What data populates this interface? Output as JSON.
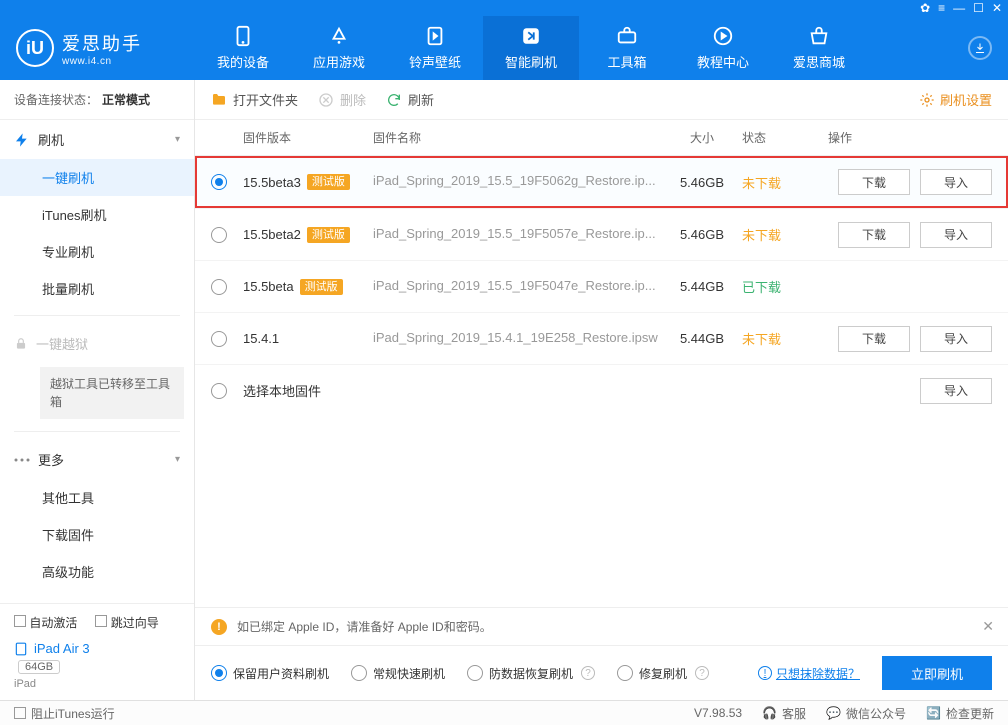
{
  "titlebar": {
    "btns": [
      "✿",
      "≡",
      "—",
      "☐",
      "✕"
    ]
  },
  "brand": {
    "name": "爱思助手",
    "url": "www.i4.cn",
    "initial": "iU"
  },
  "nav": [
    {
      "id": "device",
      "label": "我的设备"
    },
    {
      "id": "apps",
      "label": "应用游戏"
    },
    {
      "id": "ring",
      "label": "铃声壁纸"
    },
    {
      "id": "flash",
      "label": "智能刷机"
    },
    {
      "id": "tools",
      "label": "工具箱"
    },
    {
      "id": "tutorial",
      "label": "教程中心"
    },
    {
      "id": "store",
      "label": "爱思商城"
    }
  ],
  "conn": {
    "prefix": "设备连接状态：",
    "mode": "正常模式"
  },
  "menu": {
    "flash_group": "刷机",
    "flash_items": [
      "一键刷机",
      "iTunes刷机",
      "专业刷机",
      "批量刷机"
    ],
    "jailbreak": "一键越狱",
    "jailbreak_note": "越狱工具已转移至工具箱",
    "more_group": "更多",
    "more_items": [
      "其他工具",
      "下载固件",
      "高级功能"
    ]
  },
  "opts": {
    "auto_activate": "自动激活",
    "skip_guide": "跳过向导"
  },
  "device": {
    "name": "iPad Air 3",
    "capacity": "64GB",
    "type": "iPad"
  },
  "toolbar": {
    "open": "打开文件夹",
    "delete": "删除",
    "refresh": "刷新",
    "settings": "刷机设置"
  },
  "table": {
    "head": {
      "ver": "固件版本",
      "file": "固件名称",
      "size": "大小",
      "stat": "状态",
      "act": "操作"
    },
    "rows": [
      {
        "sel": true,
        "ver": "15.5beta3",
        "beta": true,
        "file": "iPad_Spring_2019_15.5_19F5062g_Restore.ip...",
        "size": "5.46GB",
        "stat": "未下载",
        "stat_cls": "undl",
        "dl": true,
        "imp": true,
        "hl": true
      },
      {
        "sel": false,
        "ver": "15.5beta2",
        "beta": true,
        "file": "iPad_Spring_2019_15.5_19F5057e_Restore.ip...",
        "size": "5.46GB",
        "stat": "未下载",
        "stat_cls": "undl",
        "dl": true,
        "imp": true
      },
      {
        "sel": false,
        "ver": "15.5beta",
        "beta": true,
        "file": "iPad_Spring_2019_15.5_19F5047e_Restore.ip...",
        "size": "5.44GB",
        "stat": "已下载",
        "stat_cls": "dl",
        "dl": false,
        "imp": false
      },
      {
        "sel": false,
        "ver": "15.4.1",
        "beta": false,
        "file": "iPad_Spring_2019_15.4.1_19E258_Restore.ipsw",
        "size": "5.44GB",
        "stat": "未下载",
        "stat_cls": "undl",
        "dl": true,
        "imp": true
      },
      {
        "sel": false,
        "ver": "选择本地固件",
        "beta": false,
        "file": "",
        "size": "",
        "stat": "",
        "stat_cls": "",
        "dl": false,
        "imp": true,
        "local": true
      }
    ],
    "beta_tag": "测试版",
    "btn_dl": "下载",
    "btn_imp": "导入"
  },
  "notice": "如已绑定 Apple ID，请准备好 Apple ID和密码。",
  "modes": {
    "items": [
      "保留用户资料刷机",
      "常规快速刷机",
      "防数据恢复刷机",
      "修复刷机"
    ],
    "erase": "只想抹除数据？",
    "flash_btn": "立即刷机"
  },
  "statusbar": {
    "block": "阻止iTunes运行",
    "ver": "V7.98.53",
    "kf": "客服",
    "wx": "微信公众号",
    "upd": "检查更新"
  }
}
